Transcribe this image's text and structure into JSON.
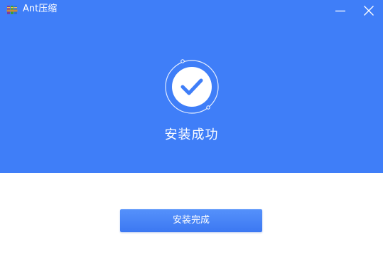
{
  "window": {
    "title": "Ant压缩",
    "icons": {
      "app": "archive-books-icon",
      "minimize": "minimize-icon",
      "close": "close-icon"
    }
  },
  "status": {
    "icon": "check-circle-icon",
    "message": "安装成功"
  },
  "actions": {
    "done_label": "安装完成"
  },
  "colors": {
    "header_background": "#3f7ef8",
    "button_background": "#4a86f7",
    "text_light": "#ffffff",
    "body_background": "#ffffff"
  }
}
